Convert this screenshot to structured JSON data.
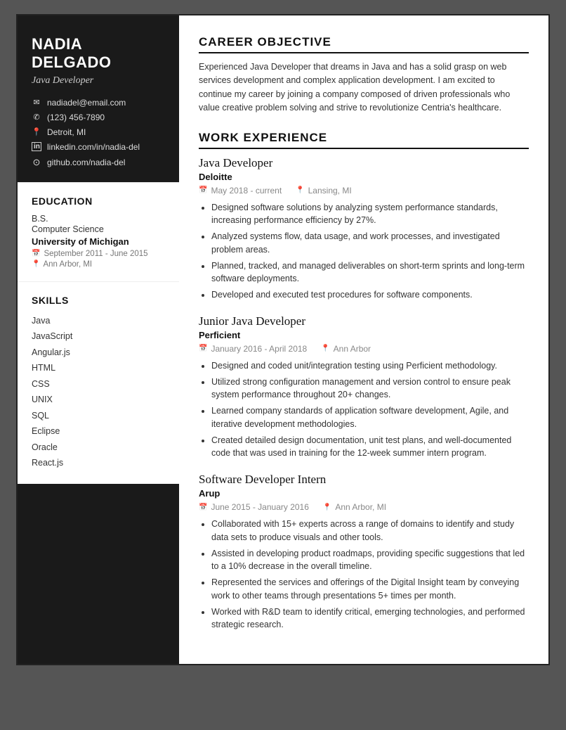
{
  "sidebar": {
    "name": "NADIA DELGADO",
    "title": "Java Developer",
    "contact": [
      {
        "icon": "✉",
        "text": "nadiadel@email.com",
        "name": "email"
      },
      {
        "icon": "✆",
        "text": "(123) 456-7890",
        "name": "phone"
      },
      {
        "icon": "📍",
        "text": "Detroit, MI",
        "name": "location"
      },
      {
        "icon": "in",
        "text": "linkedin.com/in/nadia-del",
        "name": "linkedin"
      },
      {
        "icon": "⌥",
        "text": "github.com/nadia-del",
        "name": "github"
      }
    ],
    "education": {
      "section_title": "EDUCATION",
      "degree": "B.S.",
      "field": "Computer Science",
      "school": "University of Michigan",
      "dates": "September 2011 - June 2015",
      "location": "Ann Arbor, MI"
    },
    "skills": {
      "section_title": "SKILLS",
      "items": [
        "Java",
        "JavaScript",
        "Angular.js",
        "HTML",
        "CSS",
        "UNIX",
        "SQL",
        "Eclipse",
        "Oracle",
        "React.js"
      ]
    }
  },
  "main": {
    "career_objective": {
      "title": "CAREER OBJECTIVE",
      "text": "Experienced Java Developer that dreams in Java and has a solid grasp on web services development and complex application development. I am excited to continue my career by joining a company composed of driven professionals who value creative problem solving and strive to revolutionize Centria's healthcare."
    },
    "work_experience": {
      "title": "WORK EXPERIENCE",
      "jobs": [
        {
          "title": "Java Developer",
          "company": "Deloitte",
          "dates": "May 2018 - current",
          "location": "Lansing, MI",
          "bullets": [
            "Designed software solutions by analyzing system performance standards, increasing performance efficiency by 27%.",
            "Analyzed systems flow, data usage, and work processes, and investigated problem areas.",
            "Planned, tracked, and managed deliverables on short-term sprints and long-term software deployments.",
            "Developed and executed test procedures for software components."
          ]
        },
        {
          "title": "Junior Java Developer",
          "company": "Perficient",
          "dates": "January 2016 - April 2018",
          "location": "Ann Arbor",
          "bullets": [
            "Designed and coded unit/integration testing using Perficient methodology.",
            "Utilized strong configuration management and version control to ensure peak system performance throughout 20+ changes.",
            "Learned company standards of application software development, Agile, and iterative development methodologies.",
            "Created detailed design documentation, unit test plans, and well-documented code that was used in training for the 12-week summer intern program."
          ]
        },
        {
          "title": "Software Developer Intern",
          "company": "Arup",
          "dates": "June 2015 - January 2016",
          "location": "Ann Arbor, MI",
          "bullets": [
            "Collaborated with 15+ experts across a range of domains to identify and study data sets to produce visuals and other tools.",
            "Assisted in developing product roadmaps, providing specific suggestions that led to a 10% decrease in the overall timeline.",
            "Represented the services and offerings of the Digital Insight team by conveying work to other teams through presentations 5+ times per month.",
            "Worked with R&D team to identify critical, emerging technologies, and performed strategic research."
          ]
        }
      ]
    }
  }
}
